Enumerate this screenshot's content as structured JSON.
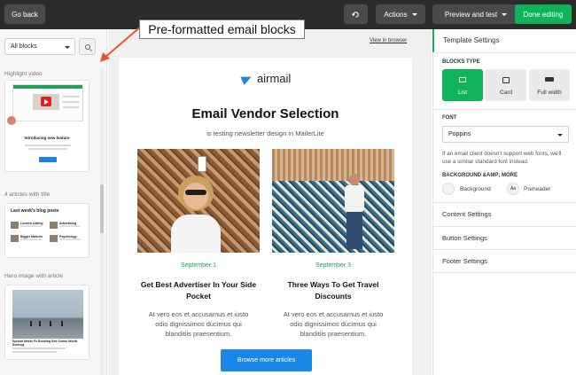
{
  "topbar": {
    "go_back": "Go back",
    "actions": "Actions",
    "preview": "Preview and test",
    "done": "Done editing"
  },
  "annotation": {
    "callout": "Pre-formatted email blocks"
  },
  "blocks_panel": {
    "filter_value": "All blocks",
    "categories": [
      {
        "label": "Highlight video",
        "thumb_title": "Introducing new feature"
      },
      {
        "label": "4 articles with title",
        "thumb_title": "Last week's blog posts",
        "thumb_items": [
          "London Calling",
          "Advertising",
          "Bigger Markets",
          "Psychology"
        ]
      },
      {
        "label": "Hero image with article",
        "thumb_title": "Spread Attirte Fx Booking Sed Summ Wordt Sentrug"
      }
    ]
  },
  "email": {
    "view_in_browser": "View in browser",
    "brand": "airmail",
    "headline": "Email Vendor Selection",
    "subline": "is testing newsletter design in MailerLite",
    "articles": [
      {
        "date": "September 1",
        "title": "Get Best Advertiser In Your Side Pocket",
        "body": "At vero eos et accusamus et iusto odio dignissimos ducimus qui blanditiis praesentium."
      },
      {
        "date": "September 3",
        "title": "Three Ways To Get Travel Discounts",
        "body": "At vero eos et accusamus et iusto odio dignissimos ducimus qui blanditiis praesentium."
      }
    ],
    "button": "Browse more articles"
  },
  "settings": {
    "title": "Template Settings",
    "blocks_type_label": "BLOCKS TYPE",
    "types": [
      "List",
      "Card",
      "Full width"
    ],
    "active_type": "List",
    "font_label": "FONT",
    "font_value": "Poppins",
    "font_note": "If an email client doesn't support web fonts, we'll use a similar standard font instead.",
    "background_label": "BACKGROUND &AMP; MORE",
    "background": "Background",
    "preheader_icon": "Aa",
    "preheader": "Preheader",
    "sections": [
      "Content Settings",
      "Button Settings",
      "Footer Settings"
    ]
  },
  "colors": {
    "accent_green": "#0fb35a",
    "accent_blue": "#1a86e8",
    "topbar": "#2b2b2b",
    "arrow": "#e8542e"
  }
}
